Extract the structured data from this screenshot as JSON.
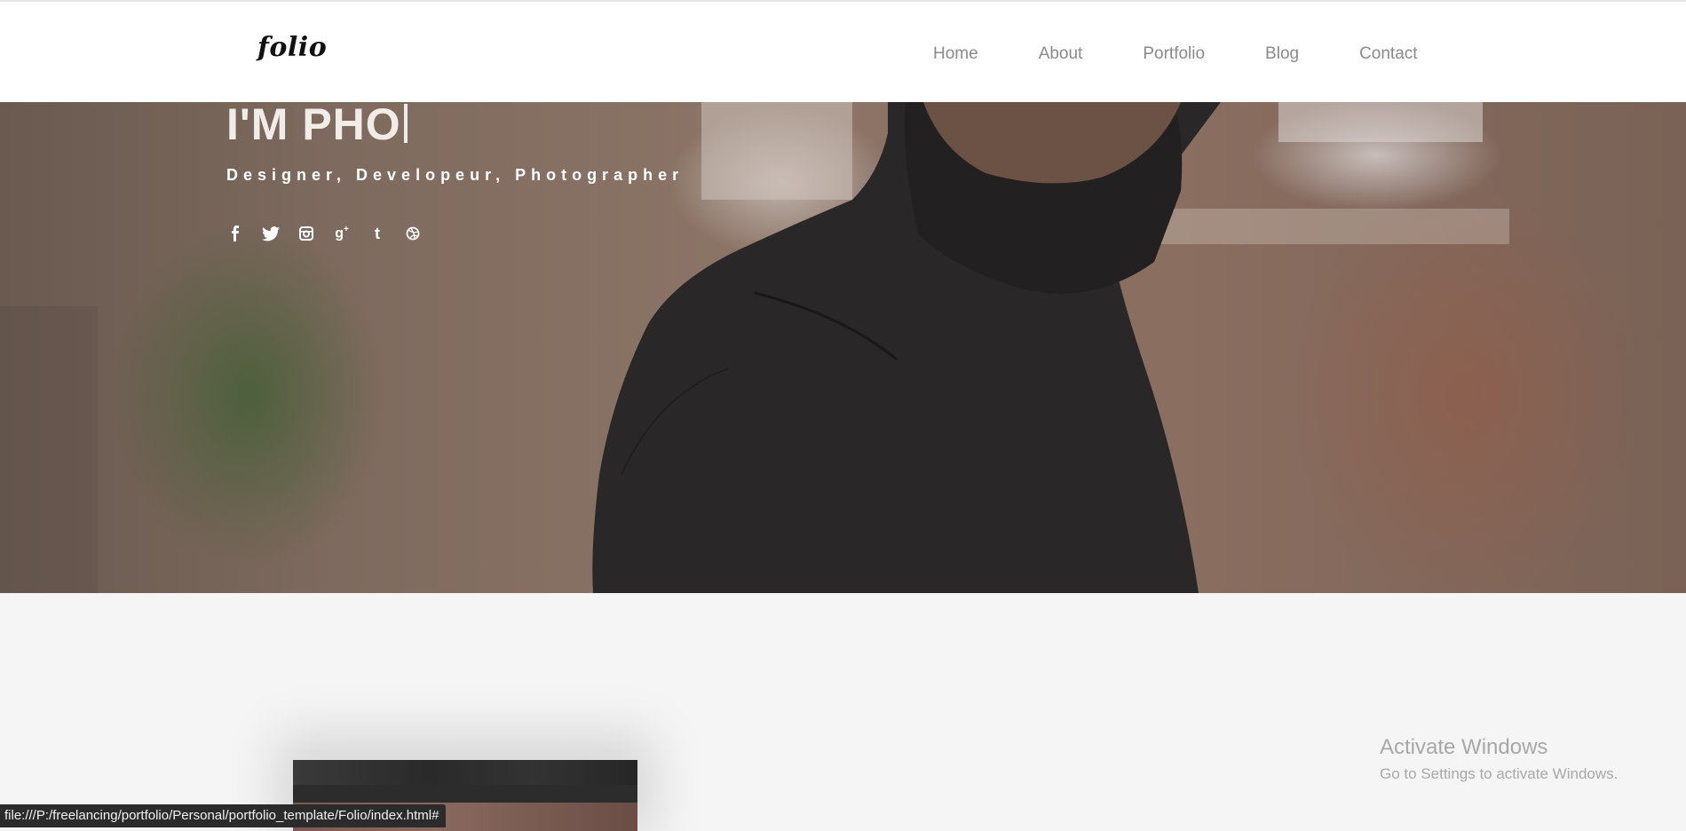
{
  "header": {
    "logo": "folio",
    "nav": [
      "Home",
      "About",
      "Portfolio",
      "Blog",
      "Contact"
    ]
  },
  "hero": {
    "title": "I'M PHO",
    "subtitle": "Designer, Developeur, Photographer",
    "social_icons": [
      "facebook-icon",
      "twitter-icon",
      "instagram-icon",
      "google-plus-icon",
      "tumblr-icon",
      "dribbble-icon"
    ]
  },
  "watermark": {
    "line1": "Activate Windows",
    "line2": "Go to Settings to activate Windows."
  },
  "status_bar": {
    "url": "file:///P:/freelancing/portfolio/Personal/portfolio_template/Folio/index.html#"
  }
}
